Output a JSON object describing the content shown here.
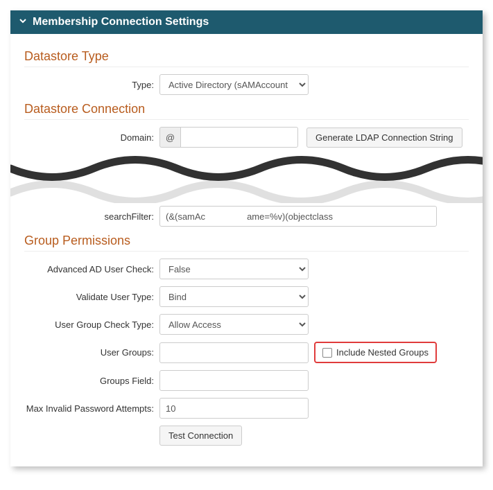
{
  "header": {
    "title": "Membership Connection Settings"
  },
  "sections": {
    "datastore_type": {
      "title": "Datastore Type",
      "type_label": "Type:",
      "type_value": "Active Directory (sAMAccount"
    },
    "datastore_connection": {
      "title": "Datastore Connection",
      "domain_label": "Domain:",
      "domain_prefix": "@",
      "domain_value": "",
      "generate_button": "Generate LDAP Connection String",
      "search_filter_label": "searchFilter:",
      "search_filter_value_left": "(&(samAc",
      "search_filter_value_right": "ame=%v)(objectclass"
    },
    "group_permissions": {
      "title": "Group Permissions",
      "advanced_check_label": "Advanced AD User Check:",
      "advanced_check_value": "False",
      "validate_user_label": "Validate User Type:",
      "validate_user_value": "Bind",
      "group_check_label": "User Group Check Type:",
      "group_check_value": "Allow Access",
      "user_groups_label": "User Groups:",
      "user_groups_value": "",
      "include_nested_label": "Include Nested Groups",
      "groups_field_label": "Groups Field:",
      "groups_field_value": "",
      "max_invalid_label": "Max Invalid Password Attempts:",
      "max_invalid_value": "10",
      "test_button": "Test Connection"
    }
  }
}
